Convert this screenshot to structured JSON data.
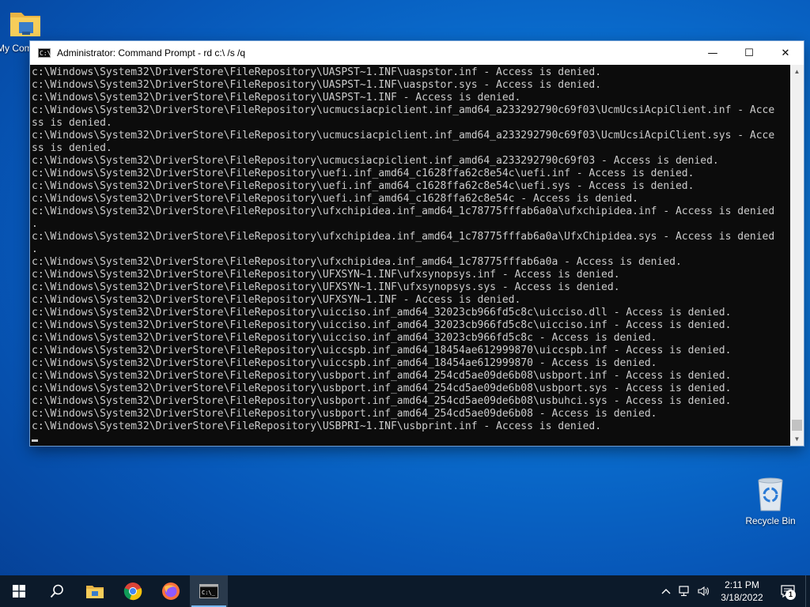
{
  "desktop": {
    "icons": [
      {
        "label": "My Computer"
      },
      {
        "label": "Recycle Bin"
      }
    ]
  },
  "window": {
    "title": "Administrator: Command Prompt - rd  c:\\ /s /q",
    "controls": {
      "minimize": "—",
      "maximize": "☐",
      "close": "✕"
    },
    "console_lines": [
      "c:\\Windows\\System32\\DriverStore\\FileRepository\\UASPST~1.INF\\uaspstor.inf - Access is denied.",
      "c:\\Windows\\System32\\DriverStore\\FileRepository\\UASPST~1.INF\\uaspstor.sys - Access is denied.",
      "c:\\Windows\\System32\\DriverStore\\FileRepository\\UASPST~1.INF - Access is denied.",
      "c:\\Windows\\System32\\DriverStore\\FileRepository\\ucmucsiacpiclient.inf_amd64_a233292790c69f03\\UcmUcsiAcpiClient.inf - Acce",
      "ss is denied.",
      "c:\\Windows\\System32\\DriverStore\\FileRepository\\ucmucsiacpiclient.inf_amd64_a233292790c69f03\\UcmUcsiAcpiClient.sys - Acce",
      "ss is denied.",
      "c:\\Windows\\System32\\DriverStore\\FileRepository\\ucmucsiacpiclient.inf_amd64_a233292790c69f03 - Access is denied.",
      "c:\\Windows\\System32\\DriverStore\\FileRepository\\uefi.inf_amd64_c1628ffa62c8e54c\\uefi.inf - Access is denied.",
      "c:\\Windows\\System32\\DriverStore\\FileRepository\\uefi.inf_amd64_c1628ffa62c8e54c\\uefi.sys - Access is denied.",
      "c:\\Windows\\System32\\DriverStore\\FileRepository\\uefi.inf_amd64_c1628ffa62c8e54c - Access is denied.",
      "c:\\Windows\\System32\\DriverStore\\FileRepository\\ufxchipidea.inf_amd64_1c78775fffab6a0a\\ufxchipidea.inf - Access is denied",
      ".",
      "c:\\Windows\\System32\\DriverStore\\FileRepository\\ufxchipidea.inf_amd64_1c78775fffab6a0a\\UfxChipidea.sys - Access is denied",
      ".",
      "c:\\Windows\\System32\\DriverStore\\FileRepository\\ufxchipidea.inf_amd64_1c78775fffab6a0a - Access is denied.",
      "c:\\Windows\\System32\\DriverStore\\FileRepository\\UFXSYN~1.INF\\ufxsynopsys.inf - Access is denied.",
      "c:\\Windows\\System32\\DriverStore\\FileRepository\\UFXSYN~1.INF\\ufxsynopsys.sys - Access is denied.",
      "c:\\Windows\\System32\\DriverStore\\FileRepository\\UFXSYN~1.INF - Access is denied.",
      "c:\\Windows\\System32\\DriverStore\\FileRepository\\uicciso.inf_amd64_32023cb966fd5c8c\\uicciso.dll - Access is denied.",
      "c:\\Windows\\System32\\DriverStore\\FileRepository\\uicciso.inf_amd64_32023cb966fd5c8c\\uicciso.inf - Access is denied.",
      "c:\\Windows\\System32\\DriverStore\\FileRepository\\uicciso.inf_amd64_32023cb966fd5c8c - Access is denied.",
      "c:\\Windows\\System32\\DriverStore\\FileRepository\\uiccspb.inf_amd64_18454ae612999870\\uiccspb.inf - Access is denied.",
      "c:\\Windows\\System32\\DriverStore\\FileRepository\\uiccspb.inf_amd64_18454ae612999870 - Access is denied.",
      "c:\\Windows\\System32\\DriverStore\\FileRepository\\usbport.inf_amd64_254cd5ae09de6b08\\usbport.inf - Access is denied.",
      "c:\\Windows\\System32\\DriverStore\\FileRepository\\usbport.inf_amd64_254cd5ae09de6b08\\usbport.sys - Access is denied.",
      "c:\\Windows\\System32\\DriverStore\\FileRepository\\usbport.inf_amd64_254cd5ae09de6b08\\usbuhci.sys - Access is denied.",
      "c:\\Windows\\System32\\DriverStore\\FileRepository\\usbport.inf_amd64_254cd5ae09de6b08 - Access is denied.",
      "c:\\Windows\\System32\\DriverStore\\FileRepository\\USBPRI~1.INF\\usbprint.inf - Access is denied."
    ]
  },
  "taskbar": {
    "items": [
      {
        "icon": "windows-start-icon"
      },
      {
        "icon": "search-icon"
      },
      {
        "icon": "file-explorer-icon"
      },
      {
        "icon": "chrome-icon"
      },
      {
        "icon": "firefox-icon"
      },
      {
        "icon": "command-prompt-icon"
      }
    ],
    "tray": {
      "time": "2:11 PM",
      "date": "3/18/2022",
      "notification_count": "1"
    }
  }
}
